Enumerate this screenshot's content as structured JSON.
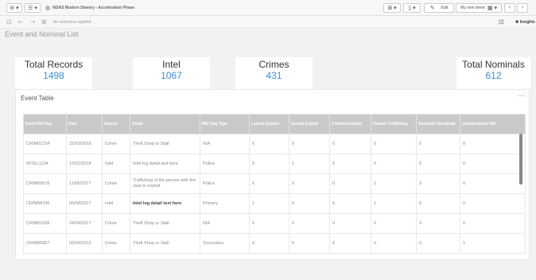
{
  "toolbar": {
    "app_title": "NDAS Modern Slavery - Acceleration Phase",
    "edit_label": "Edit",
    "sheet_selector": "My new sheet",
    "insights_label": "Insights",
    "selections_text": "No selections applied"
  },
  "sheet": {
    "title": "Event and Nominal List"
  },
  "kpis": [
    {
      "label": "Total Records",
      "value": "1498"
    },
    {
      "label": "Intel",
      "value": "1067"
    },
    {
      "label": "Crimes",
      "value": "431"
    },
    {
      "label": "Total Nominals",
      "value": "612"
    }
  ],
  "event_table": {
    "title": "Event Table",
    "more_label": "···",
    "columns": [
      "Event Ref Key",
      "Date",
      "Source",
      "Detail",
      "MS Flag Type",
      "Labour Exploit",
      "Sexual Exploit",
      "Criminal Exploit",
      "Human Trafficking",
      "Domestic Servitude",
      "Undetermined MS"
    ],
    "rows": [
      [
        "CRIM01234",
        "22/03/2018",
        "Crime",
        "Theft Shop or Stall",
        "N/A",
        "0",
        "0",
        "0",
        "0",
        "0",
        "0"
      ],
      [
        "INTEL1234",
        "13/01/2018",
        "Intel",
        "Intel log detail text here",
        "Police",
        "0",
        "1",
        "0",
        "0",
        "0",
        "0"
      ],
      [
        "CRIM05678",
        "11/06/2017",
        "Crime",
        "Trafficking of the person with the view to exploit",
        "Police",
        "0",
        "0",
        "0",
        "1",
        "0",
        "0"
      ],
      [
        "CRIM58796",
        "05/08/2017",
        "Intel",
        "Intel log detail text here",
        "Primary",
        "1",
        "0",
        "0",
        "1",
        "0",
        "0"
      ],
      [
        "CRIM01038",
        "24/04/2017",
        "Crime",
        "Theft Shop or Stall",
        "N/A",
        "0",
        "0",
        "0",
        "0",
        "0",
        "0"
      ],
      [
        "CRIM05957",
        "03/04/2015",
        "Crime",
        "Theft Shop or Stall",
        "Secondary",
        "0",
        "0",
        "0",
        "0",
        "0",
        "1"
      ]
    ]
  }
}
